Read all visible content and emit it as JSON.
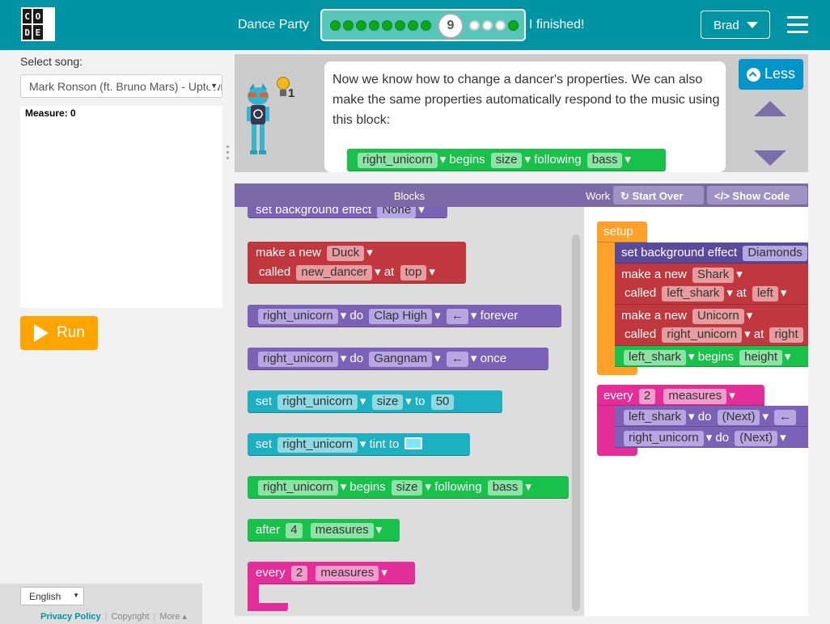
{
  "header": {
    "logo_letters": [
      "C",
      "O",
      "",
      "D",
      "E",
      ""
    ],
    "level_title": "Dance Party",
    "progress": {
      "completed": 8,
      "current": "9",
      "remaining": 4
    },
    "finished_label": "I finished!",
    "user_label": "Brad",
    "colors": {
      "bar": "#0094a4",
      "done": "#0ea61b"
    }
  },
  "sidebar": {
    "song_label": "Select song:",
    "song_value": "Mark Ronson (ft. Bruno Mars) - Uptown Funk",
    "measure_text": "Measure: 0",
    "run_label": "Run",
    "language": "English",
    "footer_links": [
      "Privacy Policy",
      "Copyright",
      "More"
    ]
  },
  "instructions": {
    "text": "Now we know how to change a dancer's properties. We can also make the same properties automatically respond to the music using this block:",
    "hint_count": "1",
    "less_label": "Less",
    "example_block": [
      "right_unicorn",
      "begins",
      "size",
      "following",
      "bass"
    ]
  },
  "toolbar": {
    "blocks_label": "Blocks",
    "workspace_label": "Work",
    "start_over_label": "Start Over",
    "show_code_label": "Show Code"
  },
  "toolbox": {
    "b0": {
      "text": "set background effect",
      "f1": "None"
    },
    "b1": {
      "t1": "make a new",
      "f1": "Duck",
      "t2": "called",
      "f2": "new_dancer",
      "t3": "at",
      "f3": "top"
    },
    "b2": {
      "f1": "right_unicorn",
      "t1": "do",
      "f2": "Clap High",
      "f3": "←",
      "t2": "forever"
    },
    "b3": {
      "f1": "right_unicorn",
      "t1": "do",
      "f2": "Gangnam",
      "f3": "←",
      "t2": "once"
    },
    "b4": {
      "t1": "set",
      "f1": "right_unicorn",
      "f2": "size",
      "t2": "to",
      "f3": "50"
    },
    "b5": {
      "t1": "set",
      "f1": "right_unicorn",
      "t2": "tint to"
    },
    "b6": {
      "f1": "right_unicorn",
      "t1": "begins",
      "f2": "size",
      "t2": "following",
      "f3": "bass"
    },
    "b7": {
      "t1": "after",
      "f1": "4",
      "f2": "measures"
    },
    "b8": {
      "t1": "every",
      "f1": "2",
      "f2": "measures"
    }
  },
  "workspace": {
    "setup_label": "setup",
    "w1": {
      "t1": "set background effect",
      "f1": "Diamonds"
    },
    "w2": {
      "t1": "make a new",
      "f1": "Shark",
      "t2": "called",
      "f2": "left_shark",
      "t3": "at",
      "f3": "left"
    },
    "w3": {
      "t1": "make a new",
      "f1": "Unicorn",
      "t2": "called",
      "f2": "right_unicorn",
      "t3": "at",
      "f3": "right"
    },
    "w4": {
      "f1": "left_shark",
      "t1": "begins",
      "f2": "height"
    },
    "w5": {
      "t1": "every",
      "f1": "2",
      "f2": "measures"
    },
    "w6": {
      "f1": "left_shark",
      "t1": "do",
      "f2": "(Next)",
      "f3": "←"
    },
    "w7": {
      "f1": "right_unicorn",
      "t1": "do",
      "f2": "(Next)"
    }
  }
}
